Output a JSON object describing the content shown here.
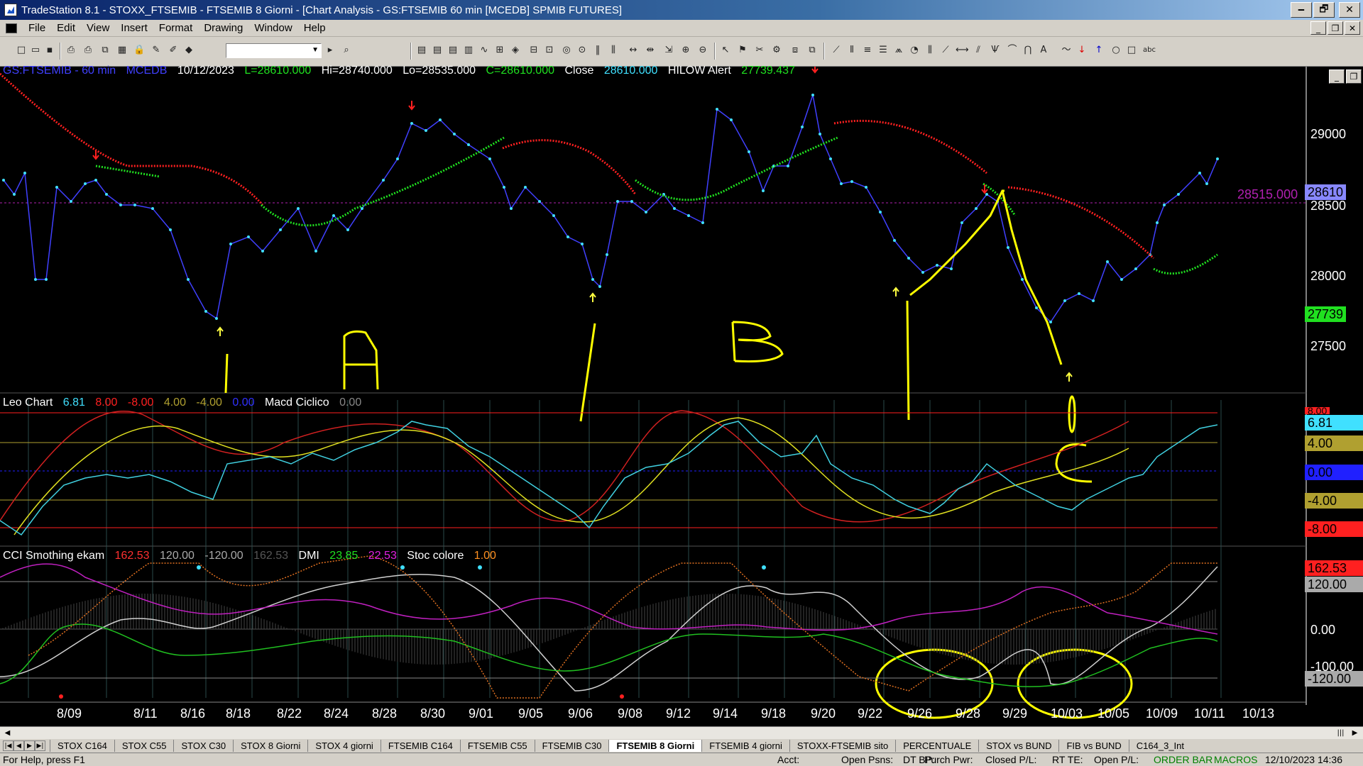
{
  "window": {
    "title": "TradeStation 8.1 - STOXX_FTSEMIB - FTSEMIB  8 Giorni - [Chart Analysis - GS:FTSEMIB  60 min  [MCEDB] SPMIB FUTURES]",
    "minimize": "🗕",
    "restore": "🗗",
    "close": "✕"
  },
  "menu": {
    "items": [
      "File",
      "Edit",
      "View",
      "Insert",
      "Format",
      "Drawing",
      "Window",
      "Help"
    ]
  },
  "chart": {
    "header": {
      "symbol": "GS:FTSEMIB - 60 min",
      "feed": "MCEDB",
      "date": "10/12/2023",
      "last": "L=28610.000",
      "high": "Hi=28740.000",
      "low": "Lo=28535.000",
      "close": "C=28610.000",
      "close_label": "Close",
      "close_value": "28610.000",
      "alert_name": "HILOW Alert",
      "alert_value": "27739.437"
    },
    "price_axis": [
      "29000",
      "28500",
      "28000",
      "27500"
    ],
    "price_tags": {
      "last": "28610",
      "line_label": "28515.000",
      "alert": "27739"
    },
    "leo_header": {
      "name": "Leo Chart",
      "v1": "6.81",
      "v2": "8.00",
      "v3": "-8.00",
      "v4": "4.00",
      "v5": "-4.00",
      "v6": "0.00",
      "name2": "Macd Ciclico",
      "v7": "0.00"
    },
    "leo_tags": [
      "8.00",
      "6.81",
      "4.00",
      "0.00",
      "-4.00",
      "-8.00"
    ],
    "cci_header": {
      "name": "CCI Smothing ekam",
      "v1": "162.53",
      "v2": "120.00",
      "v3": "-120.00",
      "v4": "162.53",
      "name2": "DMI",
      "v5": "23.85",
      "v6": "22.53",
      "name3": "Stoc colore",
      "v7": "1.00"
    },
    "cci_tags": [
      "162.53",
      "120.00",
      "0.00",
      "-100.00",
      "-120.00"
    ],
    "dates": [
      "8/09",
      "8/11",
      "8/16",
      "8/18",
      "8/22",
      "8/24",
      "8/28",
      "8/30",
      "9/01",
      "9/05",
      "9/06",
      "9/08",
      "9/12",
      "9/14",
      "9/18",
      "9/20",
      "9/22",
      "9/26",
      "9/28",
      "9/29",
      "10/03",
      "10/05",
      "10/09",
      "10/11",
      "10/13"
    ],
    "colors": {
      "price": "#4040ff",
      "price_dots": "#40e0ff",
      "ma_down": "#ff2020",
      "ma_up": "#20e020",
      "annotation": "#ffff00"
    }
  },
  "tabs": [
    "STOX C164",
    "STOX C55",
    "STOX  C30",
    "STOX  8 Giorni",
    "STOX 4 giorni",
    "FTSEMIB C164",
    "FTSEMIB C55",
    "FTSEMIB C30",
    "FTSEMIB  8 Giorni",
    "FTSEMIB  4 giorni",
    "STOXX-FTSEMIB sito",
    "PERCENTUALE",
    "STOX vs BUND",
    "FIB vs BUND",
    "C164_3_Int"
  ],
  "active_tab": "FTSEMIB  8 Giorni",
  "status": {
    "help": "For Help, press F1",
    "acct": "Acct:",
    "open_psns": "Open Psns:",
    "dt_bp": "DT BP:",
    "purch_pwr": "Purch Pwr:",
    "closed_pl": "Closed P/L:",
    "rt_te": "RT TE:",
    "open_pl": "Open P/L:",
    "order_bar": "ORDER BAR",
    "macros": "MACROS",
    "datetime": "12/10/2023 14:36"
  }
}
